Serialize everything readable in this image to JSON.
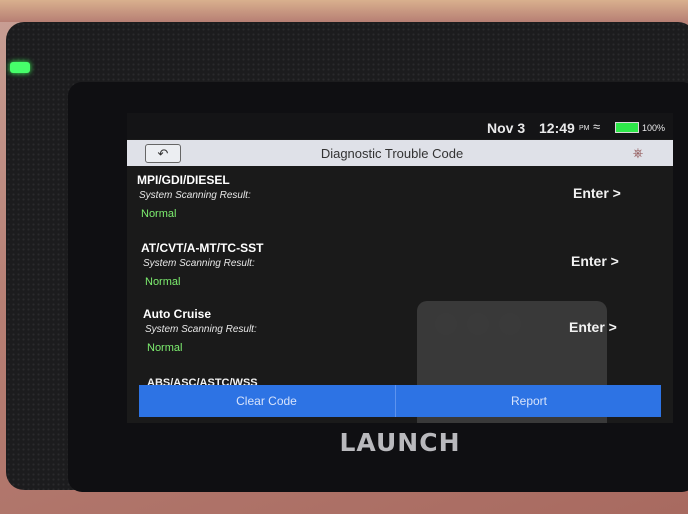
{
  "device": {
    "brand": "LAUNCH"
  },
  "status_bar": {
    "date": "Nov 3",
    "time": "12:49",
    "ampm": "PM",
    "battery": "100%",
    "wifi_icon": "wifi-icon",
    "battery_icon": "battery-icon"
  },
  "header": {
    "title": "Diagnostic Trouble Code",
    "back_icon": "back-arrow-icon",
    "exit_icon": "exit-icon"
  },
  "systems": [
    {
      "name": "MPI/GDI/DIESEL",
      "label": "System Scanning Result:",
      "status": "Normal",
      "action": "Enter >"
    },
    {
      "name": "AT/CVT/A-MT/TC-SST",
      "label": "System Scanning Result:",
      "status": "Normal",
      "action": "Enter >"
    },
    {
      "name": "Auto Cruise",
      "label": "System Scanning Result:",
      "status": "Normal",
      "action": "Enter >"
    }
  ],
  "partial_system": "ABS/ASC/ASTC/WSS",
  "buttons": {
    "clear": "Clear Code",
    "report": "Report"
  },
  "colors": {
    "accent": "#2d73e4",
    "status_normal": "#7dee6f",
    "title_bar": "#dfe1e8",
    "led": "#46ff6a"
  }
}
